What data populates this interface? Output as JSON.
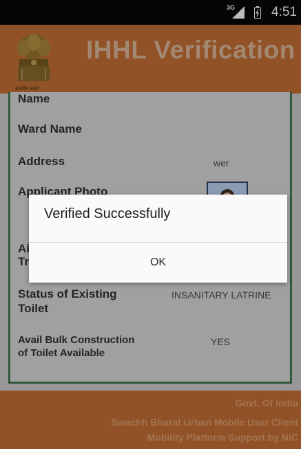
{
  "status_bar": {
    "time": "4:51",
    "network": "3G"
  },
  "header": {
    "title": "IHHL Verification",
    "emblem_caption": "सत्यमेव जयते"
  },
  "form": {
    "name_label": "Name",
    "ward_label": "Ward Name",
    "address_label": "Address",
    "address_value": "wer",
    "photo_label": "Applicant Photo",
    "partial_label_a": "Ai",
    "partial_label_b": "Tr",
    "status_label_1": "Status of Existing",
    "status_label_2": "Toilet",
    "status_value": "INSANITARY LATRINE",
    "bulk_label_1": "Avail Bulk Construction",
    "bulk_label_2": "of Toilet Available",
    "bulk_value": "YES"
  },
  "footer": {
    "line1": "Govt. Of India",
    "line2": "Swachh Bharat Urban Mobile User Client",
    "line3": "Mobility Platform Support by NIC"
  },
  "dialog": {
    "message": "Verified Successfully",
    "ok_label": "OK"
  },
  "colors": {
    "header": "#b0652f",
    "card_border": "#3d6b47",
    "status_bar": "#070707"
  }
}
